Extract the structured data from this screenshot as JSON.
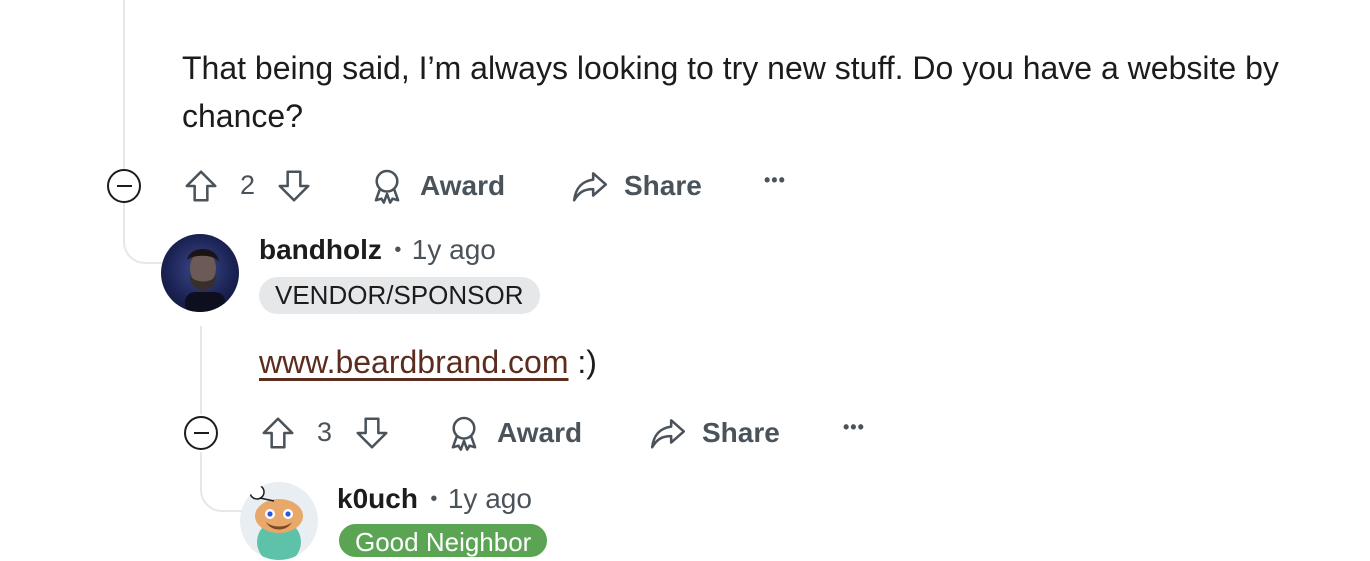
{
  "comments": [
    {
      "body_text": "That being said, I’m always looking to try new stuff. Do you have a website by chance?",
      "votes": "2",
      "award_label": "Award",
      "share_label": "Share",
      "more_label": "•••"
    },
    {
      "username": "bandholz",
      "separator": "•",
      "time": "1y ago",
      "flair": "VENDOR/SPONSOR",
      "link_text": "www.beardbrand.com",
      "trailing_text": " :)",
      "votes": "3",
      "award_label": "Award",
      "share_label": "Share",
      "more_label": "•••"
    },
    {
      "username": "k0uch",
      "separator": "•",
      "time": "1y ago",
      "flair": "Good Neighbor"
    }
  ],
  "colors": {
    "thread_line": "#e5e7e9",
    "action_text": "#4b535a",
    "flair_gray_bg": "#e5e7e9",
    "flair_green_bg": "#5aa454",
    "link": "#5c2d1e"
  },
  "icons": [
    "upvote-icon",
    "downvote-icon",
    "award-icon",
    "share-icon",
    "more-icon",
    "collapse-icon"
  ]
}
